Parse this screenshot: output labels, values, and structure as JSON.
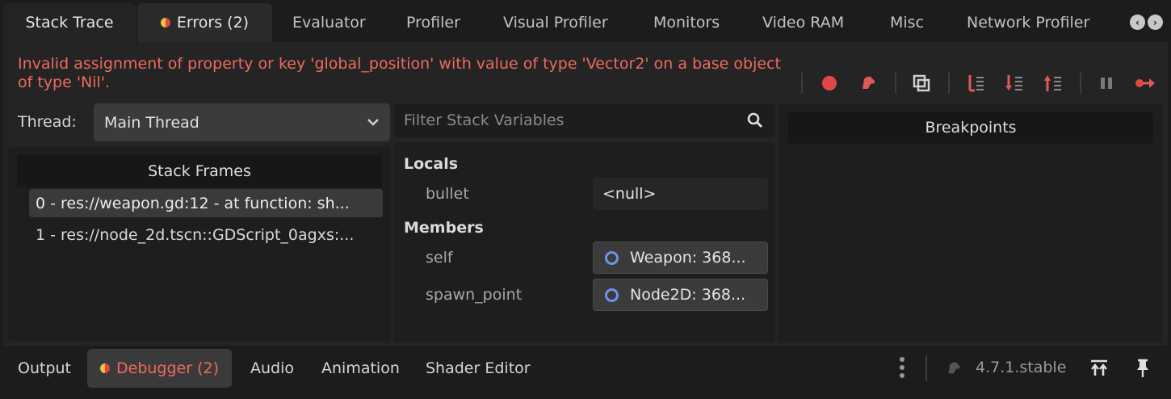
{
  "top_tabs": [
    {
      "label": "Stack Trace"
    },
    {
      "label": "Errors (2)"
    },
    {
      "label": "Evaluator"
    },
    {
      "label": "Profiler"
    },
    {
      "label": "Visual Profiler"
    },
    {
      "label": "Monitors"
    },
    {
      "label": "Video RAM"
    },
    {
      "label": "Misc"
    },
    {
      "label": "Network Profiler"
    }
  ],
  "error": {
    "message": "Invalid assignment of property or key 'global_position' with value of type 'Vector2' on a base object of type 'Nil'."
  },
  "toolbar": {
    "icons": [
      "record-icon",
      "skip-breakpoints-icon",
      "copy-error-icon",
      "step-into-icon",
      "step-over-icon",
      "step-out-icon",
      "break-icon",
      "continue-icon"
    ]
  },
  "thread": {
    "label": "Thread:",
    "value": "Main Thread"
  },
  "stack_frames": {
    "header": "Stack Frames",
    "rows": [
      {
        "text": "0 - res://weapon.gd:12 - at function: sh..."
      },
      {
        "text": "1 - res://node_2d.tscn::GDScript_0agxs:..."
      }
    ]
  },
  "variables": {
    "filter_placeholder": "Filter Stack Variables",
    "locals_title": "Locals",
    "members_title": "Members",
    "locals": [
      {
        "name": "bullet",
        "value": "<null>"
      }
    ],
    "members": [
      {
        "name": "self",
        "value": "Weapon: 368..."
      },
      {
        "name": "spawn_point",
        "value": "Node2D: 368..."
      }
    ]
  },
  "breakpoints": {
    "header": "Breakpoints"
  },
  "bottom_tabs": [
    {
      "label": "Output"
    },
    {
      "label": "Debugger (2)"
    },
    {
      "label": "Audio"
    },
    {
      "label": "Animation"
    },
    {
      "label": "Shader Editor"
    }
  ],
  "status": {
    "version": "4.7.1.stable"
  },
  "colors": {
    "error_text": "#ef6a5f",
    "record_red": "#e04848",
    "object_ring": "#6f93e8"
  }
}
